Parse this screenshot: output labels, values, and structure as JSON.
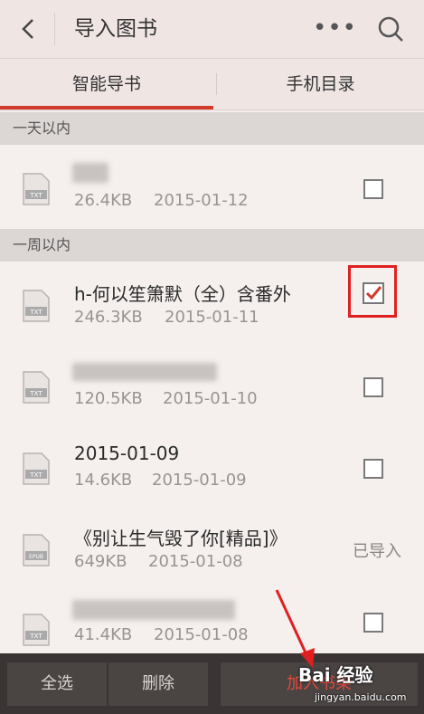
{
  "header": {
    "title": "导入图书",
    "more_label": "•••"
  },
  "tabs": [
    {
      "label": "智能导书",
      "active": true
    },
    {
      "label": "手机目录",
      "active": false
    }
  ],
  "sections": [
    {
      "title": "一天以内"
    },
    {
      "title": "一周以内"
    }
  ],
  "files": [
    {
      "name": "",
      "size": "26.4KB",
      "date": "2015-01-12",
      "type": "TXT",
      "status": "unchecked"
    },
    {
      "name": "h-何以笙箫默（全）含番外",
      "size": "246.3KB",
      "date": "2015-01-11",
      "type": "TXT",
      "status": "checked"
    },
    {
      "name": "",
      "size": "120.5KB",
      "date": "2015-01-10",
      "type": "TXT",
      "status": "unchecked"
    },
    {
      "name": "2015-01-09",
      "size": "14.6KB",
      "date": "2015-01-09",
      "type": "TXT",
      "status": "unchecked"
    },
    {
      "name": "《别让生气毁了你[精品]》",
      "size": "649KB",
      "date": "2015-01-08",
      "type": "EPUB",
      "status": "imported",
      "status_label": "已导入"
    },
    {
      "name": "",
      "size": "41.4KB",
      "date": "2015-01-08",
      "type": "TXT",
      "status": "unchecked"
    }
  ],
  "footer": {
    "select_all": "全选",
    "delete": "删除",
    "add_to_shelf": "加入书架"
  },
  "watermark": {
    "brand": "Bai 经验",
    "url": "jingyan.baidu.com"
  },
  "colors": {
    "accent": "#d23a2c",
    "highlight_box": "#e02020"
  }
}
